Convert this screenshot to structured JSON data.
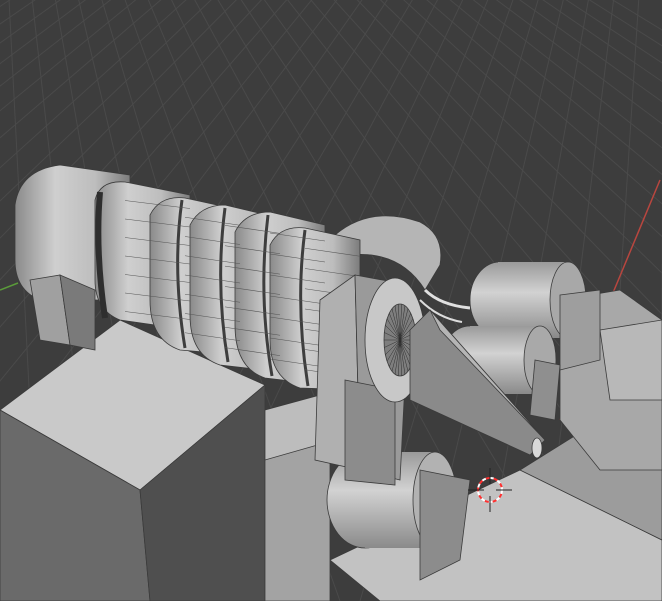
{
  "viewport": {
    "mode": "3D Viewport",
    "background_color": "#3d3d3d",
    "grid_color": "#4a4a4a",
    "x_axis_color": "#b8463f",
    "y_axis_color": "#5a9a3a",
    "model_base_color": "#c4c4c4",
    "model_shadow_color": "#8e8e8e",
    "model_dark_color": "#5a5a5a",
    "wire_color": "#3b3b3b",
    "cursor_icon": "3d-cursor-icon",
    "cursor_colors": [
      "#ff3030",
      "#ffffff"
    ]
  }
}
